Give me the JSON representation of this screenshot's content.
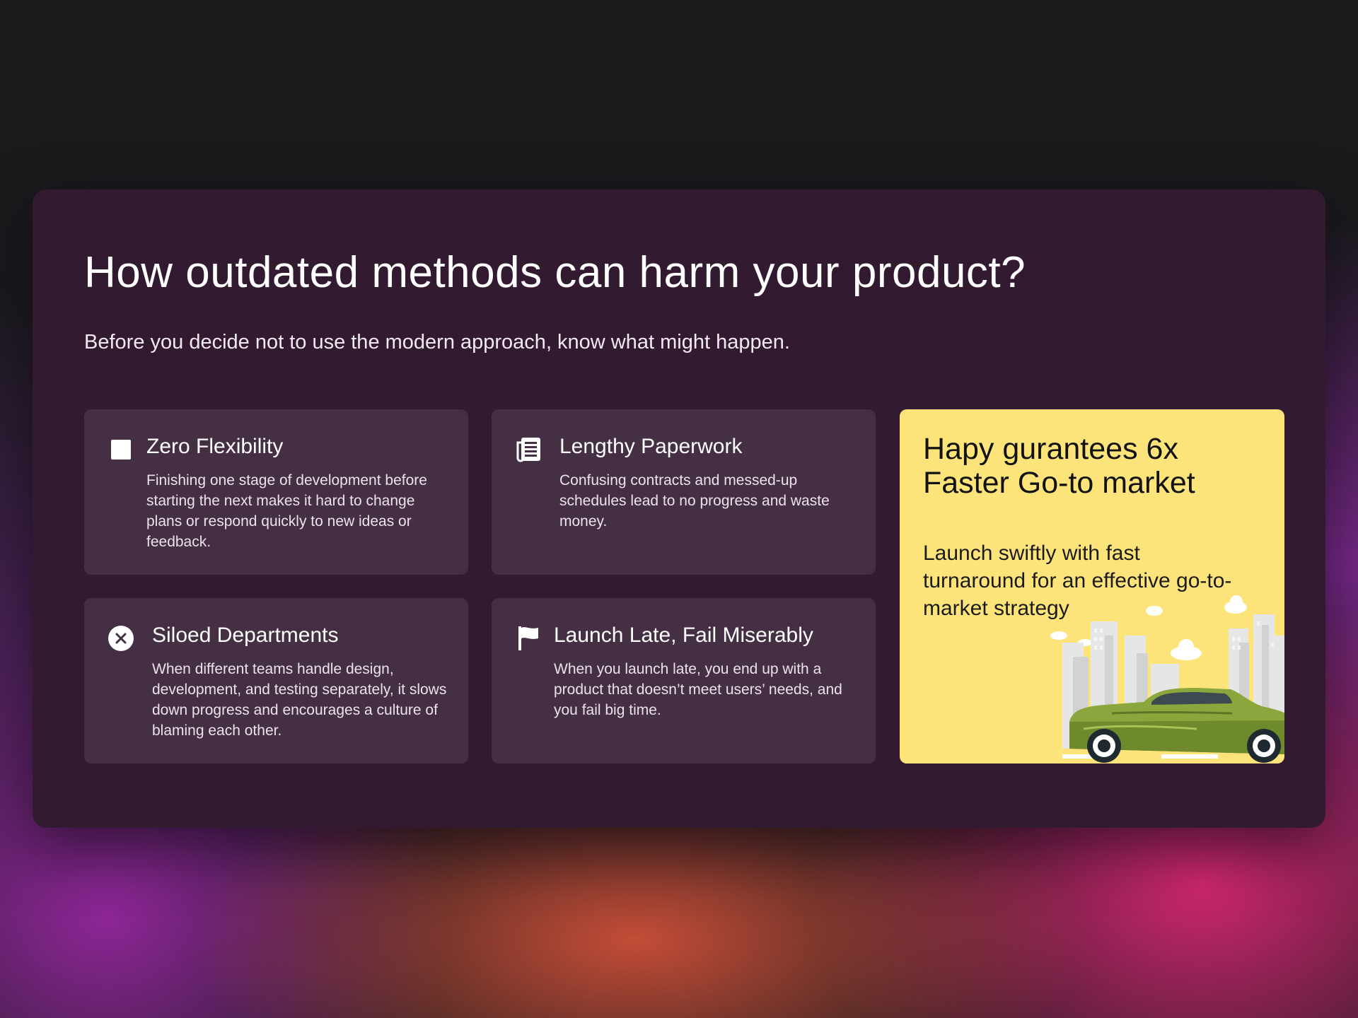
{
  "heading": {
    "title": "How outdated methods can harm your product?",
    "subtitle": "Before you decide not to use the modern approach, know what might happen."
  },
  "cards": [
    {
      "icon": "square-icon",
      "title": "Zero Flexibility",
      "body": "Finishing one stage of development before starting the next makes it hard to change plans or respond quickly to new ideas or feedback."
    },
    {
      "icon": "document-icon",
      "title": "Lengthy Paperwork",
      "body": "Confusing contracts and messed-up schedules lead to no progress and waste money."
    },
    {
      "icon": "close-circle-icon",
      "title": "Siloed Departments",
      "body": "When different teams handle design, development, and testing separately, it slows down progress and encourages a culture of blaming each other."
    },
    {
      "icon": "flag-icon",
      "title": "Launch Late, Fail Miserably",
      "body": "When you launch late, you end up with a product that doesn’t meet users’ needs, and you fail big time."
    }
  ],
  "promo": {
    "title": "Hapy gurantees 6x Faster Go-to market",
    "body": "Launch swiftly with fast turnaround for an effective go-to-market strategy",
    "illustration": "car-city-illustration",
    "background_color": "#fde47a"
  },
  "colors": {
    "panel": "#321a30",
    "card": "#442f44",
    "text": "#ffffff"
  }
}
